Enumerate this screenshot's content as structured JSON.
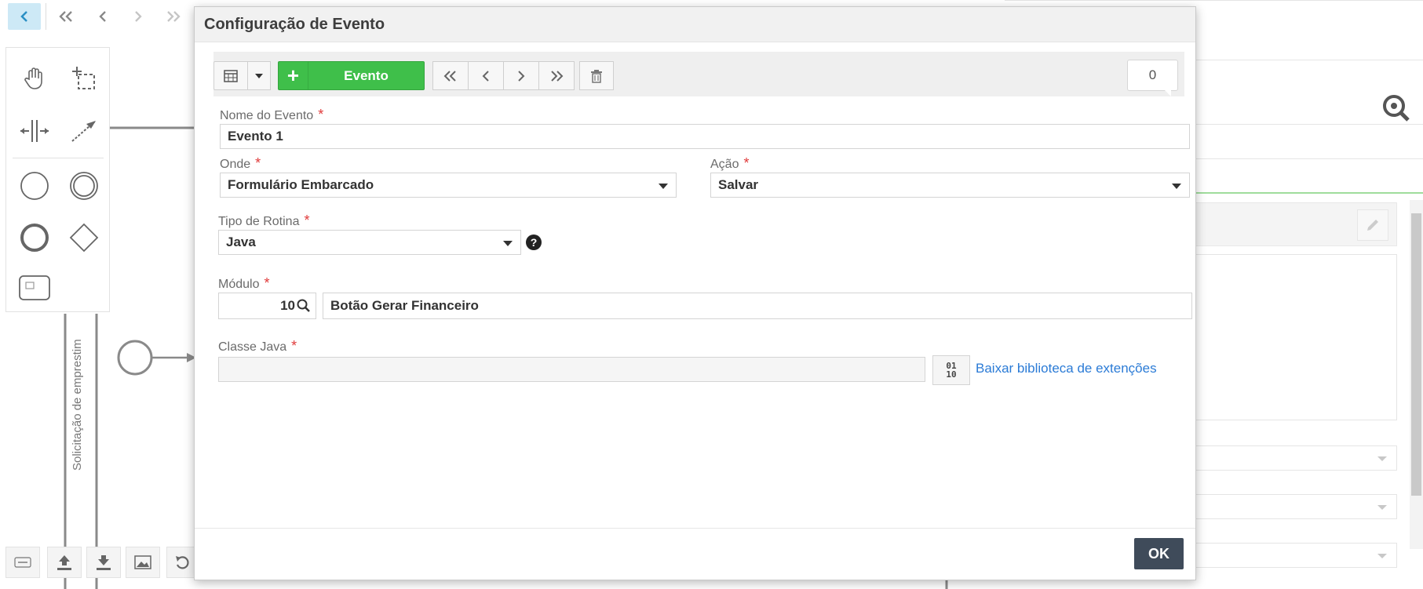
{
  "modal": {
    "title": "Configuração de Evento",
    "toolbar": {
      "add_event_label": "Evento",
      "record_count": "0"
    },
    "fields": {
      "nome": {
        "label": "Nome do Evento",
        "required_mark": "*",
        "value": "Evento 1"
      },
      "onde": {
        "label": "Onde",
        "required_mark": "*",
        "value": "Formulário Embarcado"
      },
      "acao": {
        "label": "Ação",
        "required_mark": "*",
        "value": "Salvar"
      },
      "tipo_rotina": {
        "label": "Tipo de Rotina",
        "required_mark": "*",
        "value": "Java",
        "help_symbol": "?"
      },
      "modulo": {
        "label": "Módulo",
        "required_mark": "*",
        "code": "10",
        "value": "Botão Gerar Financeiro"
      },
      "classe_java": {
        "label": "Classe Java",
        "required_mark": "*",
        "value": "",
        "download_link": "Baixar biblioteca de extenções",
        "binary_icon_text": "01\n10"
      }
    },
    "ok_label": "OK"
  },
  "background": {
    "lane_label": "Solicitação de emprestim",
    "icons": [
      "back-icon",
      "first-icon",
      "previous-icon",
      "next-icon",
      "last-icon",
      "hand-tool-icon",
      "lasso-tool-icon",
      "space-tool-icon",
      "connect-tool-icon",
      "start-event-icon",
      "intermediate-event-icon",
      "end-event-icon",
      "gateway-icon",
      "subprocess-icon",
      "zoom-icon",
      "edit-icon"
    ]
  }
}
